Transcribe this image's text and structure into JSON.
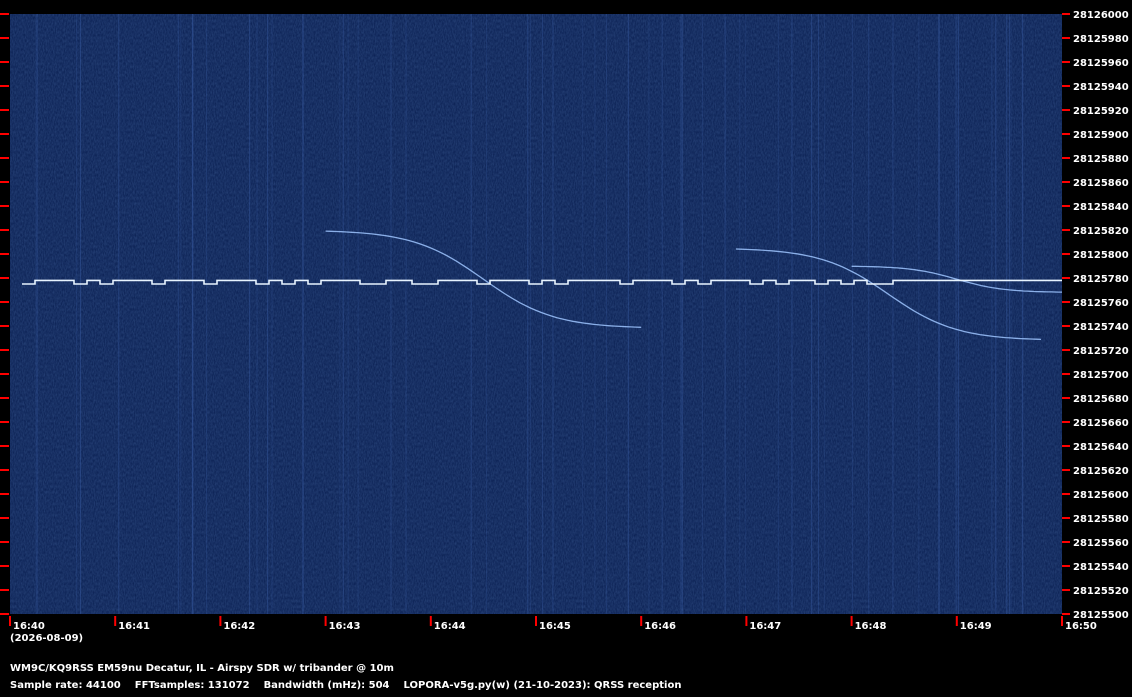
{
  "chart_data": {
    "type": "heatmap",
    "title": "",
    "xlabel": "",
    "ylabel": "",
    "x_ticks": [
      "16:40",
      "16:41",
      "16:42",
      "16:43",
      "16:44",
      "16:45",
      "16:46",
      "16:47",
      "16:48",
      "16:49",
      "16:50"
    ],
    "x_start_note": "(2026-08-09)",
    "y_ticks": [
      28126000,
      28125980,
      28125960,
      28125940,
      28125920,
      28125900,
      28125880,
      28125860,
      28125840,
      28125820,
      28125800,
      28125780,
      28125760,
      28125740,
      28125720,
      28125700,
      28125680,
      28125660,
      28125640,
      28125620,
      28125600,
      28125580,
      28125560,
      28125540,
      28125520,
      28125500
    ],
    "ylim": [
      28125500,
      28126000
    ],
    "xlim_minutes": [
      0,
      10
    ],
    "carrier": {
      "base_freq": 28125775,
      "high_freq": 28125778,
      "pattern": [
        0,
        1,
        1,
        1,
        0,
        1,
        0,
        1,
        1,
        1,
        0,
        1,
        1,
        1,
        0,
        1,
        1,
        1,
        0,
        1,
        0,
        1,
        0,
        1,
        1,
        1,
        0,
        0,
        1,
        1,
        0,
        0,
        1,
        1,
        1,
        0,
        1,
        1,
        1,
        0,
        1,
        0,
        1,
        1,
        1,
        1,
        0,
        1,
        1,
        1,
        0,
        1,
        0,
        1,
        1,
        1,
        0,
        1,
        0,
        1,
        1,
        0,
        1,
        0,
        1,
        0,
        0,
        1,
        1,
        1,
        1,
        1,
        1,
        1,
        1,
        1,
        1,
        1,
        1,
        1
      ]
    },
    "doppler_traces": [
      {
        "start_min": 3.0,
        "end_min": 6.0,
        "f_start": 28125820,
        "f_end": 28125738
      },
      {
        "start_min": 6.9,
        "end_min": 9.8,
        "f_start": 28125805,
        "f_end": 28125728
      },
      {
        "start_min": 8.0,
        "end_min": 10.0,
        "f_start": 28125790,
        "f_end": 28125768
      }
    ],
    "colors": {
      "background": "#0e2457",
      "noise": "#1d3a7a",
      "trace": "#e8f4ff",
      "tick": "#ff0000",
      "text": "#ffffff"
    }
  },
  "captions": {
    "station": "WM9C/KQ9RSS EM59nu Decatur, IL - Airspy SDR w/ tribander @ 10m",
    "sample_rate": "Sample rate: 44100",
    "fft_samples": "FFTsamples: 131072",
    "bandwidth": "Bandwidth (mHz): 504",
    "software": "LOPORA-v5g.py(w) (21-10-2023): QRSS reception"
  }
}
